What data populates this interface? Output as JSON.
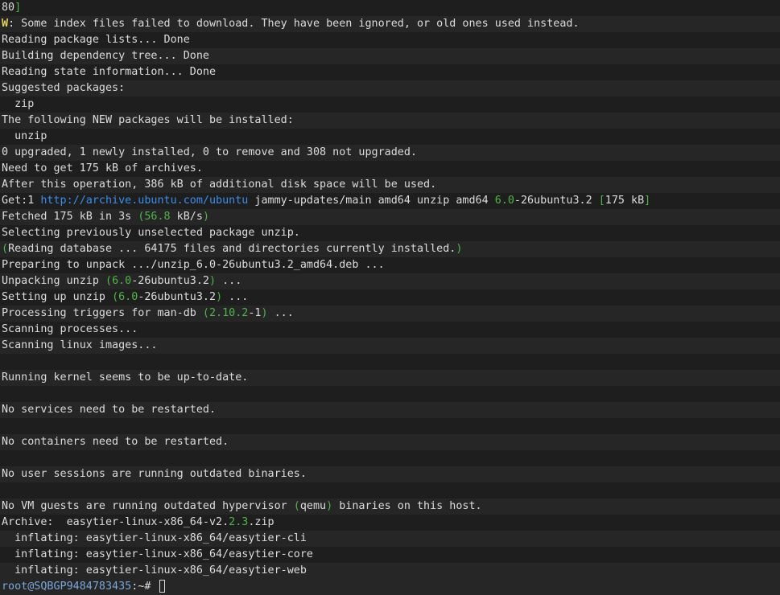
{
  "colors": {
    "background": "#1e1e1e",
    "foreground": "#dcdcdc",
    "warning": "#e5d25a",
    "url": "#3b8eea",
    "number": "#4fb548",
    "prompt_user": "#7aa6da"
  },
  "lines": [
    [
      {
        "t": "80",
        "c": "default"
      },
      {
        "t": "]",
        "c": "num"
      }
    ],
    [
      {
        "t": "W",
        "c": "warn"
      },
      {
        "t": ": Some index files failed to download. They have been ignored, or old ones used instead.",
        "c": "default"
      }
    ],
    [
      {
        "t": "Reading package lists... Done",
        "c": "default"
      }
    ],
    [
      {
        "t": "Building dependency tree... Done",
        "c": "default"
      }
    ],
    [
      {
        "t": "Reading state information... Done",
        "c": "default"
      }
    ],
    [
      {
        "t": "Suggested packages:",
        "c": "default"
      }
    ],
    [
      {
        "t": "  zip",
        "c": "default"
      }
    ],
    [
      {
        "t": "The following NEW packages will be installed:",
        "c": "default"
      }
    ],
    [
      {
        "t": "  unzip",
        "c": "default"
      }
    ],
    [
      {
        "t": "0 upgraded, 1 newly installed, 0 to remove and 308 not upgraded.",
        "c": "default"
      }
    ],
    [
      {
        "t": "Need to get 175 kB of archives.",
        "c": "default"
      }
    ],
    [
      {
        "t": "After this operation, 386 kB of additional disk space will be used.",
        "c": "default"
      }
    ],
    [
      {
        "t": "Get:1 ",
        "c": "default"
      },
      {
        "t": "http://archive.ubuntu.com/ubuntu",
        "c": "url"
      },
      {
        "t": " jammy-updates/main amd64 unzip amd64 ",
        "c": "default"
      },
      {
        "t": "6.0",
        "c": "num"
      },
      {
        "t": "-26ubuntu3.2 ",
        "c": "default"
      },
      {
        "t": "[",
        "c": "num"
      },
      {
        "t": "175 kB",
        "c": "default"
      },
      {
        "t": "]",
        "c": "num"
      }
    ],
    [
      {
        "t": "Fetched 175 kB in 3s ",
        "c": "default"
      },
      {
        "t": "(",
        "c": "num"
      },
      {
        "t": "56.8",
        "c": "num"
      },
      {
        "t": " kB/s",
        "c": "default"
      },
      {
        "t": ")",
        "c": "num"
      }
    ],
    [
      {
        "t": "Selecting previously unselected package unzip.",
        "c": "default"
      }
    ],
    [
      {
        "t": "(",
        "c": "num"
      },
      {
        "t": "Reading database ... 64175 files and directories currently installed.",
        "c": "default"
      },
      {
        "t": ")",
        "c": "num"
      }
    ],
    [
      {
        "t": "Preparing to unpack .../unzip_6.0-26ubuntu3.2_amd64.deb ...",
        "c": "default"
      }
    ],
    [
      {
        "t": "Unpacking unzip ",
        "c": "default"
      },
      {
        "t": "(",
        "c": "num"
      },
      {
        "t": "6.0",
        "c": "num"
      },
      {
        "t": "-26ubuntu3.2",
        "c": "default"
      },
      {
        "t": ")",
        "c": "num"
      },
      {
        "t": " ...",
        "c": "default"
      }
    ],
    [
      {
        "t": "Setting up unzip ",
        "c": "default"
      },
      {
        "t": "(",
        "c": "num"
      },
      {
        "t": "6.0",
        "c": "num"
      },
      {
        "t": "-26ubuntu3.2",
        "c": "default"
      },
      {
        "t": ")",
        "c": "num"
      },
      {
        "t": " ...",
        "c": "default"
      }
    ],
    [
      {
        "t": "Processing triggers for man-db ",
        "c": "default"
      },
      {
        "t": "(",
        "c": "num"
      },
      {
        "t": "2.10.2",
        "c": "num"
      },
      {
        "t": "-1",
        "c": "default"
      },
      {
        "t": ")",
        "c": "num"
      },
      {
        "t": " ...",
        "c": "default"
      }
    ],
    [
      {
        "t": "Scanning processes...",
        "c": "default"
      }
    ],
    [
      {
        "t": "Scanning linux images...",
        "c": "default"
      }
    ],
    [
      {
        "t": "",
        "c": "default"
      }
    ],
    [
      {
        "t": "Running kernel seems to be up-to-date.",
        "c": "default"
      }
    ],
    [
      {
        "t": "",
        "c": "default"
      }
    ],
    [
      {
        "t": "No services need to be restarted.",
        "c": "default"
      }
    ],
    [
      {
        "t": "",
        "c": "default"
      }
    ],
    [
      {
        "t": "No containers need to be restarted.",
        "c": "default"
      }
    ],
    [
      {
        "t": "",
        "c": "default"
      }
    ],
    [
      {
        "t": "No user sessions are running outdated binaries.",
        "c": "default"
      }
    ],
    [
      {
        "t": "",
        "c": "default"
      }
    ],
    [
      {
        "t": "No VM guests are running outdated hypervisor ",
        "c": "default"
      },
      {
        "t": "(",
        "c": "num"
      },
      {
        "t": "qemu",
        "c": "default"
      },
      {
        "t": ")",
        "c": "num"
      },
      {
        "t": " binaries on this host.",
        "c": "default"
      }
    ],
    [
      {
        "t": "Archive:  easytier-linux-x86_64-v2.",
        "c": "default"
      },
      {
        "t": "2.3",
        "c": "num"
      },
      {
        "t": ".zip",
        "c": "default"
      }
    ],
    [
      {
        "t": "  inflating: easytier-linux-x86_64/easytier-cli",
        "c": "default"
      }
    ],
    [
      {
        "t": "  inflating: easytier-linux-x86_64/easytier-core",
        "c": "default"
      }
    ],
    [
      {
        "t": "  inflating: easytier-linux-x86_64/easytier-web",
        "c": "default"
      }
    ]
  ],
  "prompt": {
    "user_host": "root@SQBGP9484783435",
    "path_symbol": ":~# "
  }
}
